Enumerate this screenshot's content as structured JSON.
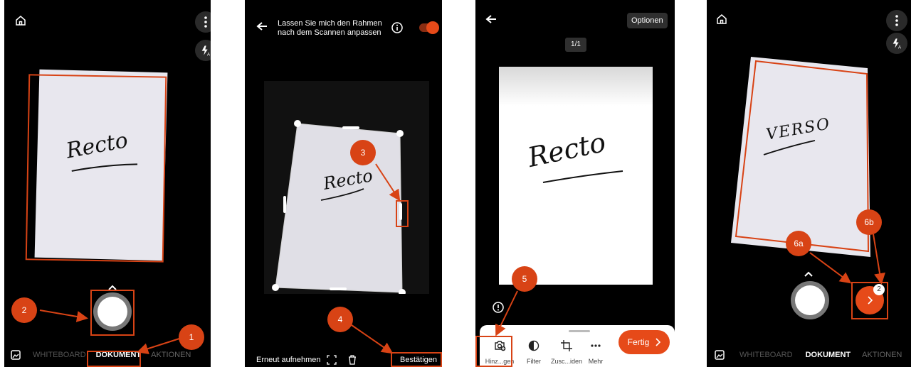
{
  "panel1": {
    "paper_text": "Recto",
    "modes": [
      "WHITEBOARD",
      "DOKUMENT",
      "AKTIONEN"
    ],
    "icons": {
      "home": "home-icon",
      "more": "more-vertical-icon",
      "flash": "flash-auto-icon",
      "gallery": "gallery-icon",
      "chevron": "chevron-up-icon"
    }
  },
  "panel2": {
    "header_line1": "Lassen Sie mich den Rahmen",
    "header_line2": "nach dem Scannen anpassen",
    "paper_text": "Recto",
    "retake_label": "Erneut aufnehmen",
    "confirm_label": "Bestätigen",
    "icons": {
      "back": "arrow-left-icon",
      "info": "info-icon",
      "expand": "expand-icon",
      "delete": "trash-icon"
    },
    "toggle_on": true
  },
  "panel3": {
    "options_label": "Optionen",
    "page_counter": "1/1",
    "paper_text": "Recto",
    "tools": [
      "Hinz...gen",
      "Filter",
      "Zusc...iden",
      "Mehr"
    ],
    "done_label": "Fertig",
    "icons": {
      "back": "arrow-left-icon",
      "alert": "alert-icon",
      "add": "add-image-icon",
      "filter": "filter-icon",
      "crop": "crop-icon",
      "more": "more-horizontal-icon",
      "next": "chevron-right-icon"
    }
  },
  "panel4": {
    "paper_text": "VERSO",
    "modes": [
      "WHITEBOARD",
      "DOKUMENT",
      "AKTIONEN"
    ],
    "badge_count": "2",
    "icons": {
      "home": "home-icon",
      "more": "more-vertical-icon",
      "flash": "flash-auto-icon",
      "gallery": "gallery-icon",
      "chevron": "chevron-up-icon",
      "next": "chevron-right-icon"
    }
  },
  "callouts": [
    "1",
    "2",
    "3",
    "4",
    "5",
    "6a",
    "6b"
  ],
  "colors": {
    "accent": "#d84315",
    "background": "#000000"
  }
}
